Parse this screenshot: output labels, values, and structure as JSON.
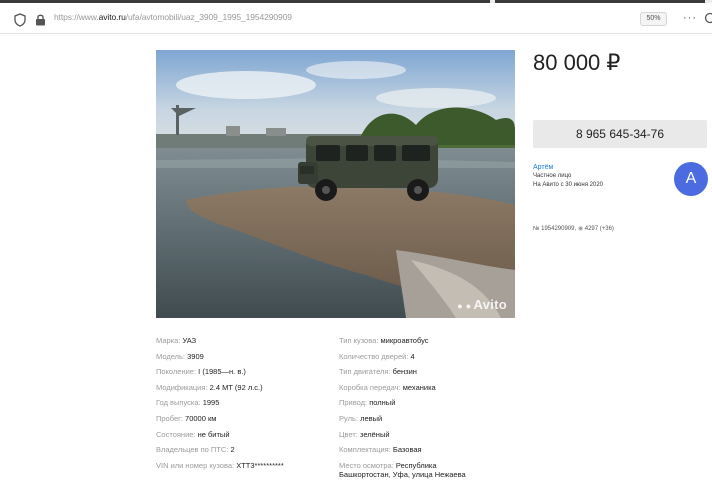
{
  "browser": {
    "url_prefix": "https://www.",
    "url_host": "avito.ru",
    "url_path": "/ufa/avtomobili/uaz_3909_1995_1954290909",
    "zoom": "50%",
    "more": "···"
  },
  "listing": {
    "price": "80 000 ₽",
    "phone_button": "8 965 645-34-76",
    "seller": {
      "name": "Артём",
      "type": "Частное лицо",
      "since": "На Авито с 30 июня 2020",
      "avatar_letter": "A"
    },
    "item_number": "№ 1954290909,",
    "views": "4297 (+36)",
    "watermark": "Avito"
  },
  "params_left": [
    {
      "key": "Марка:",
      "value": "УАЗ"
    },
    {
      "key": "Модель:",
      "value": "3909"
    },
    {
      "key": "Поколение:",
      "value": "I (1985—н. в.)"
    },
    {
      "key": "Модификация:",
      "value": "2.4 MT (92 л.с.)"
    },
    {
      "key": "Год выпуска:",
      "value": "1995"
    },
    {
      "key": "Пробег:",
      "value": "70000 км"
    },
    {
      "key": "Состояние:",
      "value": "не битый"
    },
    {
      "key": "Владельцев по ПТС:",
      "value": "2"
    },
    {
      "key": "VIN или номер кузова:",
      "value": "XTT3**********"
    }
  ],
  "params_right": [
    {
      "key": "Тип кузова:",
      "value": "микроавтобус"
    },
    {
      "key": "Количество дверей:",
      "value": "4"
    },
    {
      "key": "Тип двигателя:",
      "value": "бензин"
    },
    {
      "key": "Коробка передач:",
      "value": "механика"
    },
    {
      "key": "Привод:",
      "value": "полный"
    },
    {
      "key": "Руль:",
      "value": "левый"
    },
    {
      "key": "Цвет:",
      "value": "зелёный"
    },
    {
      "key": "Комплектация:",
      "value": "Базовая"
    }
  ],
  "inspection_place": {
    "key": "Место осмотра:",
    "value_line1": "Республика",
    "value_line2": "Башкортостан, Уфа, улица Нежаева"
  },
  "colors": {
    "accent": "#1a7cd6",
    "avatar": "#4d6be0",
    "button_bg": "#e9e9e9"
  }
}
